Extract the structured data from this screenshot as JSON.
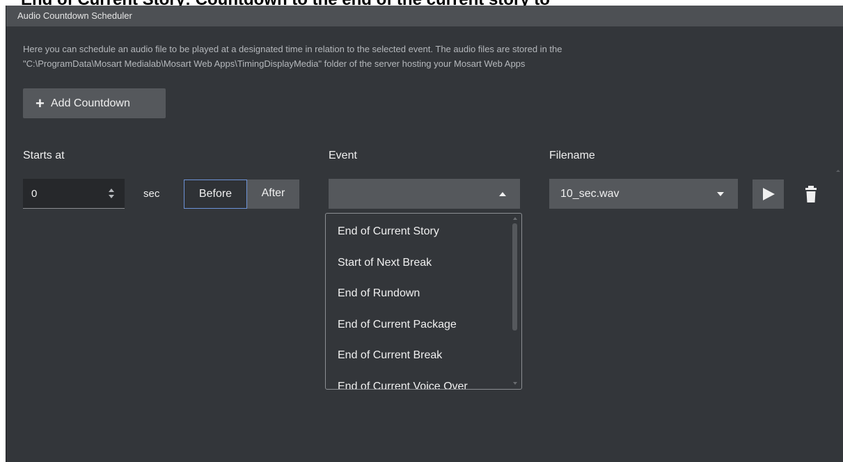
{
  "overlay_text": "End of Current Story: Countdown to the end of the current story to",
  "window": {
    "title": "Audio Countdown Scheduler"
  },
  "description": {
    "line1": "Here you can schedule an audio file to be played at a designated time in relation to the selected event. The audio files are stored in the",
    "line2": "\"C:\\ProgramData\\Mosart Medialab\\Mosart Web Apps\\TimingDisplayMedia\" folder of the server hosting your Mosart Web Apps"
  },
  "add_button": {
    "icon": "plus-icon",
    "label": "Add Countdown"
  },
  "columns": {
    "starts_at": "Starts at",
    "event": "Event",
    "filename": "Filename"
  },
  "row": {
    "starts_at_value": "0",
    "unit": "sec",
    "before_label": "Before",
    "after_label": "After",
    "selected_toggle": "Before",
    "event_value": "",
    "filename_value": "10_sec.wav",
    "play_icon": "play-icon",
    "delete_icon": "trash-icon"
  },
  "event_dropdown": {
    "open": true,
    "options": [
      "End of Current Story",
      "Start of Next Break",
      "End of Rundown",
      "End of Current Package",
      "End of Current Break",
      "End of Current Voice Over"
    ]
  },
  "colors": {
    "background": "#33363a",
    "titlebar": "#4d5054",
    "control": "#55585c",
    "input": "#26282b",
    "selected_border": "#6d93d8",
    "text": "#f0f0f0",
    "muted_text": "#b5b8bc"
  }
}
